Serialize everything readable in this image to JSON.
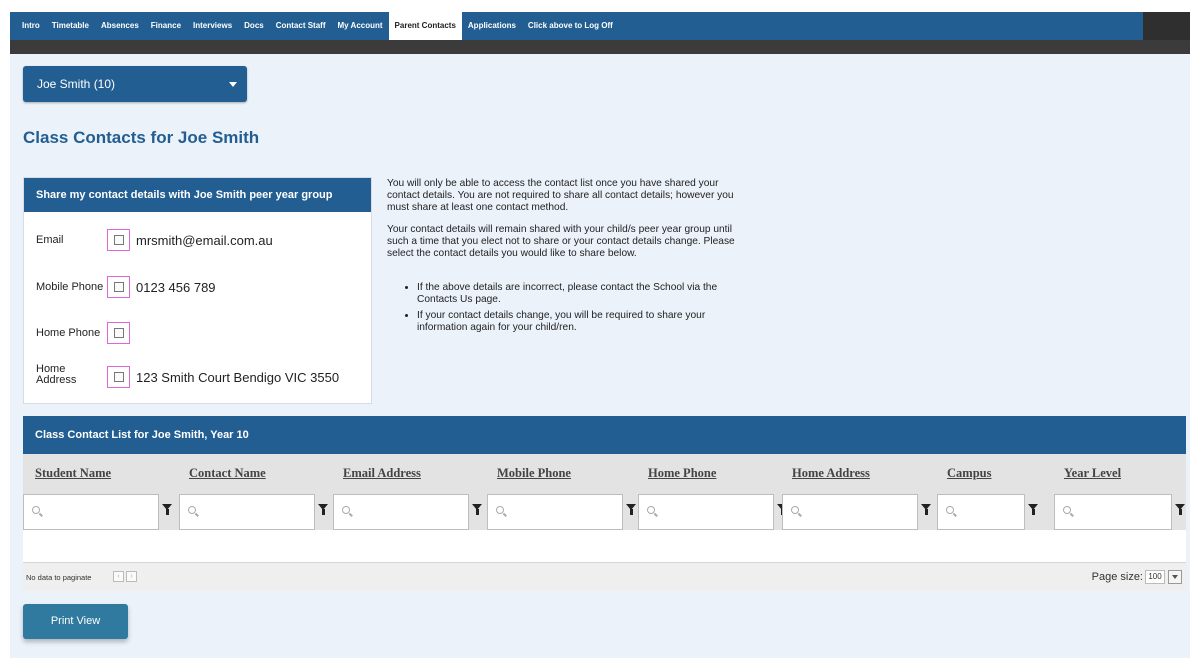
{
  "nav": {
    "items": [
      {
        "label": "Intro"
      },
      {
        "label": "Timetable"
      },
      {
        "label": "Absences"
      },
      {
        "label": "Finance"
      },
      {
        "label": "Interviews"
      },
      {
        "label": "Docs"
      },
      {
        "label": "Contact Staff"
      },
      {
        "label": "My Account"
      },
      {
        "label": "Parent Contacts",
        "active": true
      },
      {
        "label": "Applications"
      },
      {
        "label": "Click above to Log Off"
      }
    ]
  },
  "student_select": {
    "value": "Joe Smith (10)"
  },
  "page_title": "Class Contacts for Joe Smith",
  "share_panel": {
    "title": "Share my contact details with Joe Smith peer year group",
    "rows": [
      {
        "label": "Email",
        "value": "mrsmith@email.com.au",
        "checked": false
      },
      {
        "label": "Mobile Phone",
        "value": "0123 456 789",
        "checked": false
      },
      {
        "label": "Home Phone",
        "value": "",
        "checked": false
      },
      {
        "label": "Home Address",
        "value": "123 Smith Court Bendigo VIC 3550",
        "checked": false
      }
    ]
  },
  "info": {
    "paragraph1": "You will only be able to access the contact list once you have shared your contact details. You are not required to share all contact details; however you must share at least one contact method.",
    "paragraph2": "Your contact details will remain shared with your child/s peer year group until such a time that you elect not to share or your contact details change. Please select the contact details you would like to share below.",
    "bullets": [
      "If the above details are incorrect, please contact the School via the Contacts Us page.",
      "If your contact details change, you will be required to share your information again for your child/ren."
    ]
  },
  "contact_list": {
    "title": "Class Contact List for Joe Smith, Year 10",
    "columns": [
      "Student Name",
      "Contact Name",
      "Email Address",
      "Mobile Phone",
      "Home Phone",
      "Home Address",
      "Campus",
      "Year Level"
    ],
    "no_data_text": "No data to paginate",
    "page_size_label": "Page size:",
    "page_size_value": "100"
  },
  "print_button": {
    "label": "Print View"
  },
  "icons": {
    "dropdown": "caret-down-icon",
    "filter": "funnel-icon",
    "search": "magnifier-icon",
    "pager_prev": "chevron-left-icon",
    "pager_next": "chevron-right-icon"
  },
  "colors": {
    "primary": "#225e92",
    "page_background": "#ecf2fa",
    "checkbox_highlight": "#e066d6",
    "print_button": "#2f7a9e"
  }
}
